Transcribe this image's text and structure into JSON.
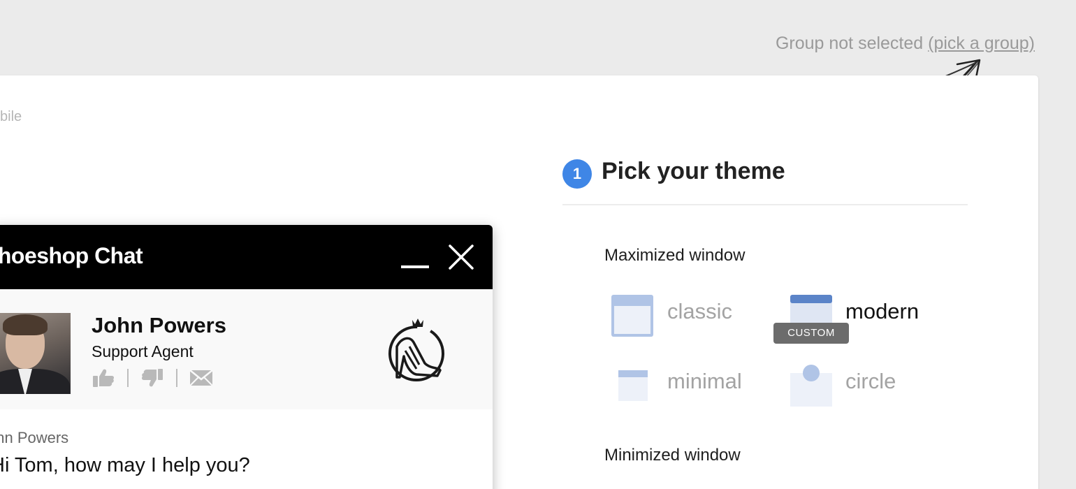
{
  "group_selector": {
    "status_text": "Group not selected",
    "link_text": "(pick a group)"
  },
  "card": {
    "mobile_tab_label": "bile"
  },
  "chat_preview": {
    "title": "Shoeshop Chat",
    "agent": {
      "name": "John Powers",
      "role": "Support Agent"
    },
    "icons": [
      "minimize-icon",
      "close-icon",
      "thumbs-up-icon",
      "thumbs-down-icon",
      "envelope-icon",
      "shoe-logo-icon"
    ],
    "message": {
      "author": "ohn Powers",
      "text": "Hi Tom, how may I help you?"
    },
    "colors": {
      "header": "#000000",
      "agent_bar": "#f9f9f9"
    }
  },
  "theme_picker": {
    "step_number": "1",
    "title": "Pick your theme",
    "maximized_label": "Maximized window",
    "minimized_label": "Minimized window",
    "themes": [
      {
        "name": "classic",
        "selected": false
      },
      {
        "name": "modern",
        "selected": true,
        "badge": "CUSTOM"
      },
      {
        "name": "minimal",
        "selected": false
      },
      {
        "name": "circle",
        "selected": false
      }
    ],
    "colors": {
      "accent": "#3f86e6",
      "theme_icon": "#b0c4e6",
      "theme_icon_selected": "#5b84c8"
    }
  }
}
